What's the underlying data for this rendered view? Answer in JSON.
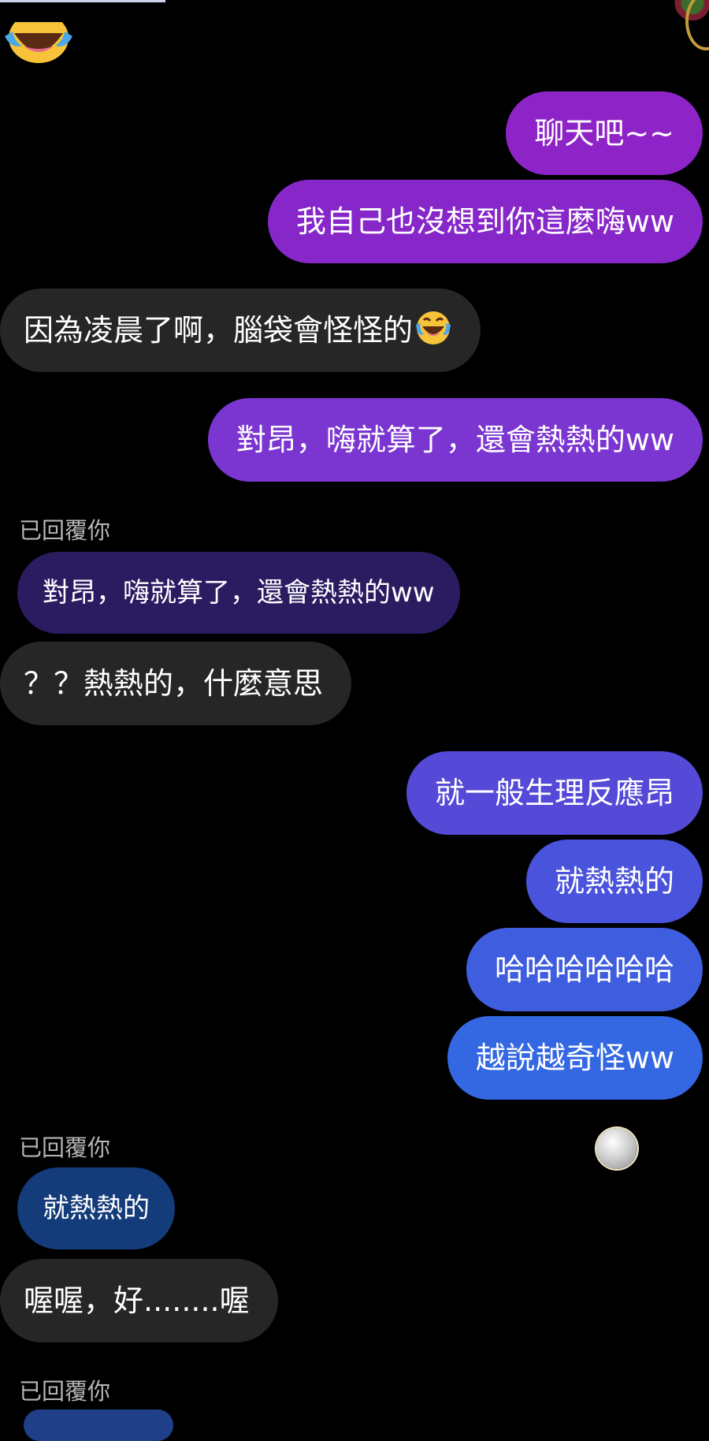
{
  "messages": [
    {
      "type": "sent",
      "text": "聊天吧~~",
      "color": "#8e24c8"
    },
    {
      "type": "sent",
      "text": "我自己也沒想到你這麼嗨ww",
      "color": "#8727c9"
    },
    {
      "type": "received",
      "text": "因為凌晨了啊，腦袋會怪怪的",
      "emoji": "face-with-tears-of-joy-icon"
    },
    {
      "type": "sent",
      "text": "對昂，嗨就算了，還會熱熱的ww",
      "color": "#7b35d0"
    },
    {
      "type": "reply_label",
      "text": "已回覆你"
    },
    {
      "type": "quote",
      "text": "對昂，嗨就算了，還會熱熱的ww",
      "color": "#2b1c62"
    },
    {
      "type": "received",
      "text": "？？熱熱的，什麼意思"
    },
    {
      "type": "sent",
      "text": "就一般生理反應昂",
      "color": "#5549d8"
    },
    {
      "type": "sent",
      "text": "就熱熱的",
      "color": "#4a53dc"
    },
    {
      "type": "sent",
      "text": "哈哈哈哈哈哈",
      "color": "#3f5ddf"
    },
    {
      "type": "sent",
      "text": "越說越奇怪ww",
      "color": "#3467e2"
    },
    {
      "type": "reply_label",
      "text": "已回覆你"
    },
    {
      "type": "quote",
      "text": "就熱熱的",
      "color": "#143c7a"
    },
    {
      "type": "received",
      "text": "喔喔，好........喔"
    },
    {
      "type": "reply_label",
      "text": "已回覆你"
    }
  ]
}
